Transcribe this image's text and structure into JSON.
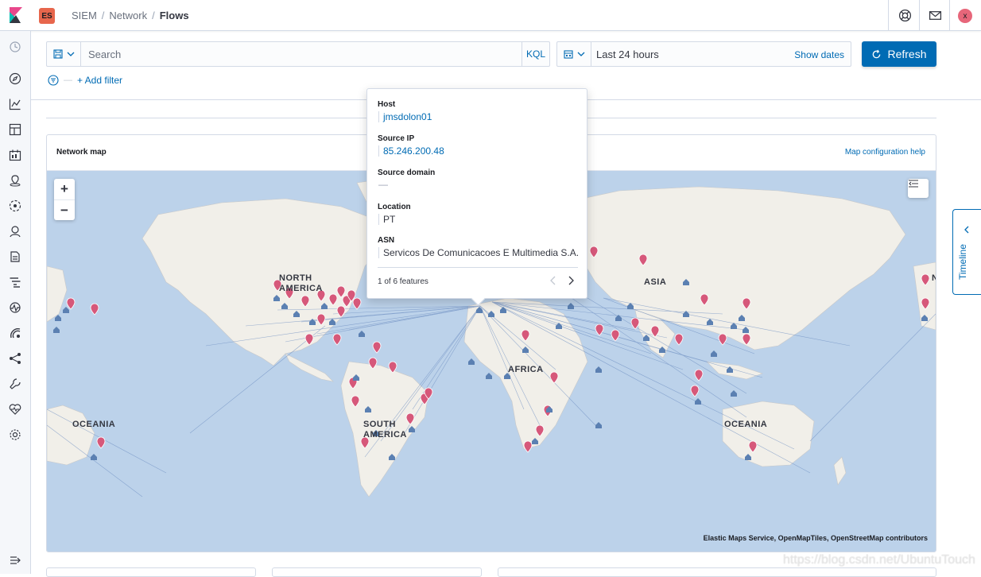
{
  "header": {
    "space_badge": "ES",
    "breadcrumbs": [
      "SIEM",
      "Network",
      "Flows"
    ],
    "avatar_initial": "x"
  },
  "query_bar": {
    "search_placeholder": "Search",
    "language": "KQL",
    "date_range": "Last 24 hours",
    "show_dates_label": "Show dates",
    "refresh_label": "Refresh",
    "add_filter_label": "+ Add filter"
  },
  "map_panel": {
    "title": "Network map",
    "help_link": "Map configuration help",
    "attribution": "Elastic Maps Service, OpenMapTiles, OpenStreetMap contributors",
    "zoom_in": "+",
    "zoom_out": "−",
    "region_labels": {
      "north_america": "NORTH AMERICA",
      "asia": "ASIA",
      "africa": "AFRICA",
      "south_america": "SOUTH AMERICA",
      "oceania_west": "OCEANIA",
      "oceania_east": "OCEANIA",
      "north_america_right": "N"
    }
  },
  "tooltip": {
    "fields": [
      {
        "label": "Host",
        "value": "jmsdolon01"
      },
      {
        "label": "Source IP",
        "value": "85.246.200.48"
      },
      {
        "label": "Source domain",
        "value": "—"
      },
      {
        "label": "Location",
        "value": "PT"
      },
      {
        "label": "ASN",
        "value": "Servicos De Comunicacoes E Multimedia S.A."
      }
    ],
    "feature_count": "1 of 6 features"
  },
  "timeline": {
    "label": "Timeline"
  },
  "watermark": "https://blog.csdn.net/UbuntuTouch",
  "colors": {
    "accent": "#006bb4",
    "ocean": "#bcd2ea",
    "land": "#f1efe9",
    "pin": "#d6587a",
    "house": "#5b80b2",
    "badge": "#e7664c",
    "avatar": "#e7667a"
  }
}
